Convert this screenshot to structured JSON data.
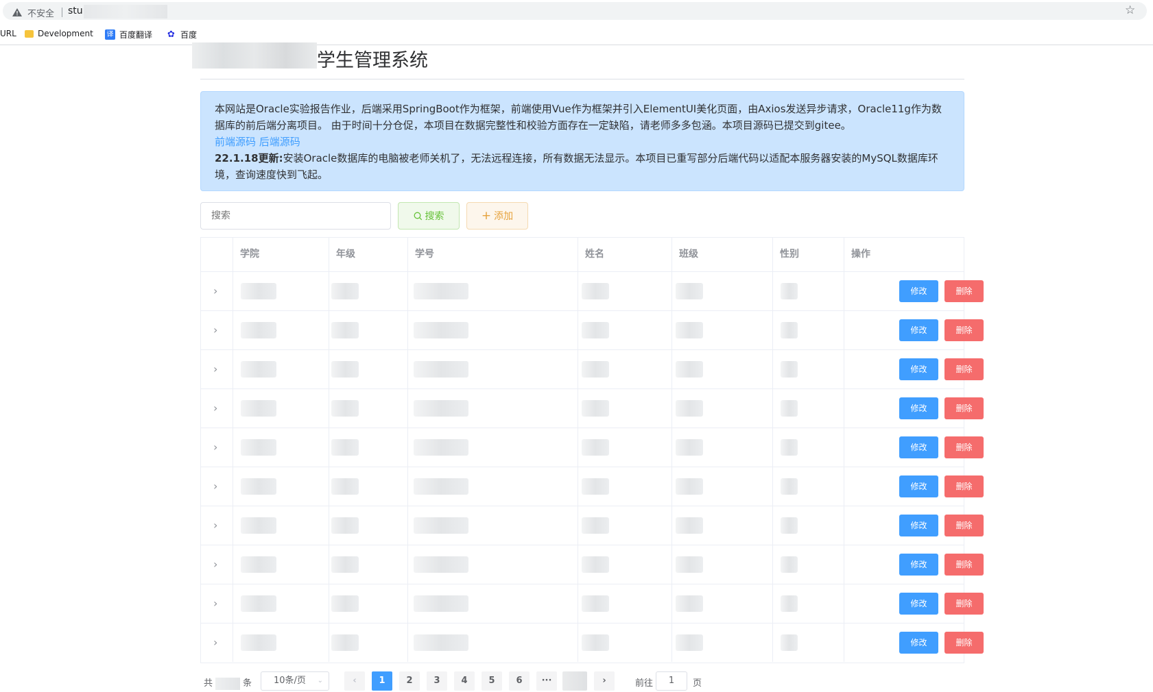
{
  "browser": {
    "insecure_label": "不安全",
    "url_visible": "stu"
  },
  "bookmarks": [
    {
      "label": "URL",
      "icon": "none"
    },
    {
      "label": "Development",
      "icon": "folder-icon"
    },
    {
      "label": "百度翻译",
      "icon": "translate-icon"
    },
    {
      "label": "百度",
      "icon": "baidu-paw-icon"
    }
  ],
  "page": {
    "title": "学生管理系统"
  },
  "notice": {
    "line1": "本网站是Oracle实验报告作业，后端采用SpringBoot作为框架，前端使用Vue作为框架并引入ElementUI美化页面，由Axios发送异步请求，Oracle11g作为数据库的前后端分离项目。 由于时间十分仓促，本项目在数据完整性和校验方面存在一定缺陷，请老师多多包涵。本项目源码已提交到gitee。",
    "frontend_link": "前端源码",
    "backend_link": "后端源码",
    "update_label": "22.1.18更新:",
    "update_text": "安装Oracle数据库的电脑被老师关机了，无法远程连接，所有数据无法显示。本项目已重写部分后端代码以适配本服务器安装的MySQL数据库环境，查询速度快到飞起。"
  },
  "toolbar": {
    "search_placeholder": "搜索",
    "search_button": "搜索",
    "add_button": "添加"
  },
  "table": {
    "headers": [
      "学院",
      "年级",
      "学号",
      "姓名",
      "班级",
      "性别",
      "操作"
    ],
    "edit_label": "修改",
    "delete_label": "删除",
    "row_count": 10
  },
  "pagination": {
    "total_prefix": "共",
    "total_suffix": "条",
    "page_size": "10条/页",
    "pages": [
      "1",
      "2",
      "3",
      "4",
      "5",
      "6"
    ],
    "ellipsis": "···",
    "current_page": "1",
    "goto_prefix": "前往",
    "goto_suffix": "页",
    "prev_arrow": "‹",
    "next_arrow": "›"
  },
  "colors": {
    "primary": "#409eff",
    "danger": "#f56c6c",
    "success": "#67c23a",
    "warning": "#e6a23c",
    "alert_bg": "#cbe4fe"
  }
}
